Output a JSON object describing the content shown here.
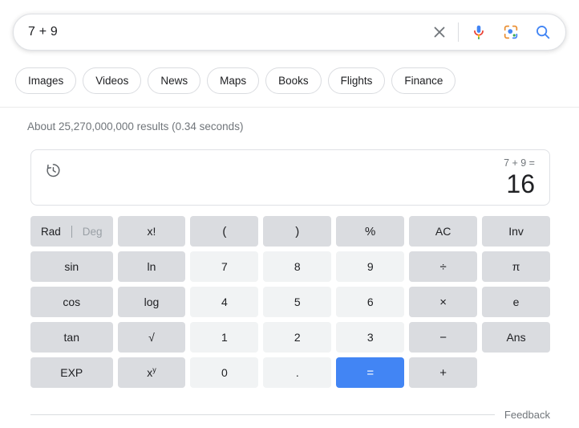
{
  "search": {
    "query": "7 + 9",
    "placeholder": "Search",
    "clear_icon": "close-icon",
    "mic_icon": "microphone-icon",
    "lens_icon": "google-lens-icon",
    "search_icon": "search-icon"
  },
  "filters": {
    "chips": [
      {
        "label": "Images"
      },
      {
        "label": "Videos"
      },
      {
        "label": "News"
      },
      {
        "label": "Maps"
      },
      {
        "label": "Books"
      },
      {
        "label": "Flights"
      },
      {
        "label": "Finance"
      }
    ]
  },
  "results": {
    "count_text": "About 25,270,000,000 results (0.34 seconds)"
  },
  "calculator": {
    "history_icon": "history-icon",
    "expression": "7 + 9 =",
    "result": "16",
    "angle_mode": {
      "active": "Rad",
      "inactive": "Deg"
    },
    "keys": [
      {
        "label": "Rad|Deg",
        "type": "radeg"
      },
      {
        "label": "x!",
        "type": "func"
      },
      {
        "label": "(",
        "type": "func"
      },
      {
        "label": ")",
        "type": "func"
      },
      {
        "label": "%",
        "type": "func"
      },
      {
        "label": "AC",
        "type": "func"
      },
      {
        "label": "Inv",
        "type": "func"
      },
      {
        "label": "sin",
        "type": "func"
      },
      {
        "label": "ln",
        "type": "func"
      },
      {
        "label": "7",
        "type": "digit"
      },
      {
        "label": "8",
        "type": "digit"
      },
      {
        "label": "9",
        "type": "digit"
      },
      {
        "label": "÷",
        "type": "op"
      },
      {
        "label": "π",
        "type": "func"
      },
      {
        "label": "cos",
        "type": "func"
      },
      {
        "label": "log",
        "type": "func"
      },
      {
        "label": "4",
        "type": "digit"
      },
      {
        "label": "5",
        "type": "digit"
      },
      {
        "label": "6",
        "type": "digit"
      },
      {
        "label": "×",
        "type": "op"
      },
      {
        "label": "e",
        "type": "func"
      },
      {
        "label": "tan",
        "type": "func"
      },
      {
        "label": "√",
        "type": "func"
      },
      {
        "label": "1",
        "type": "digit"
      },
      {
        "label": "2",
        "type": "digit"
      },
      {
        "label": "3",
        "type": "digit"
      },
      {
        "label": "−",
        "type": "op"
      },
      {
        "label": "Ans",
        "type": "func"
      },
      {
        "label": "EXP",
        "type": "func"
      },
      {
        "label": "xy",
        "type": "power"
      },
      {
        "label": "0",
        "type": "digit"
      },
      {
        "label": ".",
        "type": "digit"
      },
      {
        "label": "=",
        "type": "equals"
      },
      {
        "label": "+",
        "type": "op"
      }
    ]
  },
  "footer": {
    "feedback_label": "Feedback"
  },
  "colors": {
    "accent_blue": "#4285f4",
    "key_function": "#dadce0",
    "key_digit": "#f1f3f4",
    "text_primary": "#202124",
    "text_secondary": "#70757a"
  }
}
